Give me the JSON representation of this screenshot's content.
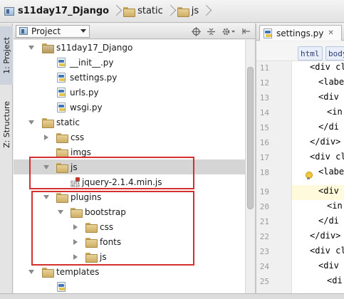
{
  "breadcrumb": [
    {
      "label": "s11day17_Django",
      "icon": "project-icon",
      "bold": true
    },
    {
      "label": "static",
      "icon": "folder-icon",
      "bold": false
    },
    {
      "label": "js",
      "icon": "folder-icon",
      "bold": false
    }
  ],
  "toolstrip": {
    "project_tab": "1: Project",
    "structure_tab": "Z: Structure"
  },
  "panel": {
    "selector_label": "Project",
    "tool_icons": [
      "locate-icon",
      "collapse-icon",
      "settings-gear-icon",
      "hide-icon"
    ]
  },
  "tree": {
    "root": "s11day17_Django",
    "root_files": [
      "__init__.py",
      "settings.py",
      "urls.py",
      "wsgi.py"
    ],
    "static": "static",
    "css": "css",
    "imgs": "imgs",
    "js": "js",
    "jquery_file": "jquery-2.1.4.min.js",
    "plugins": "plugins",
    "bootstrap": "bootstrap",
    "bootstrap_children": [
      "css",
      "fonts",
      "js"
    ],
    "templates": "templates"
  },
  "editor": {
    "tab_label": "settings.py",
    "tag_chips": [
      "html",
      "body"
    ],
    "line_numbers": [
      "11",
      "12",
      "13",
      "14",
      "15",
      "16",
      "17",
      "18",
      "19",
      "20",
      "21",
      "22",
      "23",
      "24",
      "25"
    ],
    "code_lines": [
      "<div cl",
      "<labe",
      "<div",
      "<in",
      "</di",
      "</div>",
      "<div cl",
      "<labe",
      "<div",
      "<in",
      "</di",
      "</div>",
      "<div cl",
      "<div",
      "<di"
    ],
    "current_line": "19"
  },
  "colors": {
    "highlight_box": "#d62f2f",
    "selection": "#d5d5d5",
    "folder": "#e0c47f"
  }
}
